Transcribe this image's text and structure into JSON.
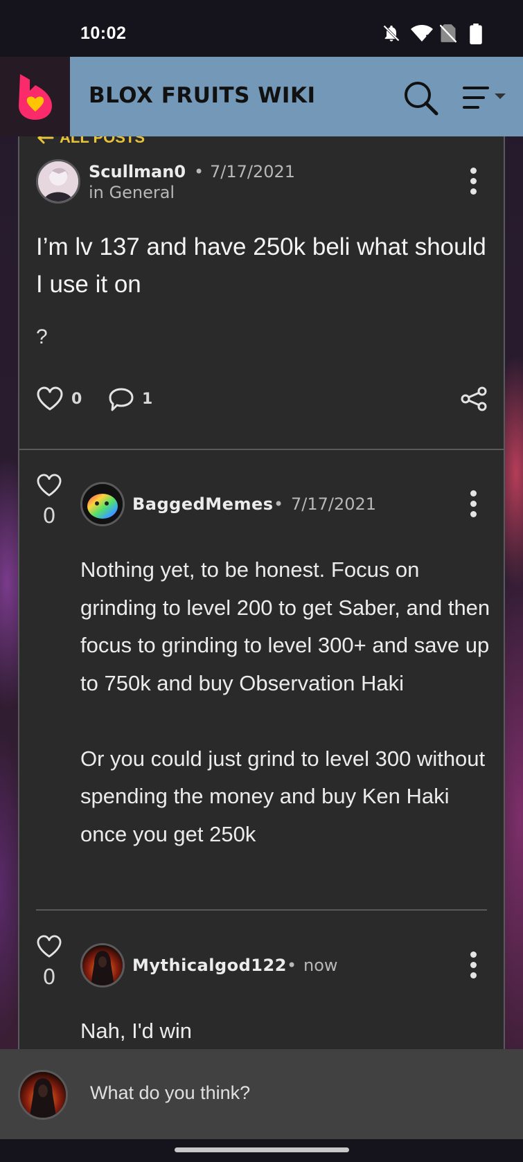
{
  "status_bar": {
    "time": "10:02",
    "icons": [
      "bell-off-icon",
      "wifi-icon",
      "no-sim-icon",
      "battery-icon"
    ]
  },
  "header": {
    "title": "BLOX FRUITS WIKI",
    "accent_color": "#7498b8",
    "logo_color": "#fa2a6b"
  },
  "nav": {
    "all_posts_label": "ALL POSTS"
  },
  "post": {
    "author": "Scullman0",
    "separator": "•",
    "date": "7/17/2021",
    "category": "in General",
    "title": "I’m lv 137 and have 250k beli what should I use it on",
    "body": "?",
    "likes": "0",
    "comments": "1"
  },
  "replies": [
    {
      "author": "BaggedMemes",
      "separator": "•",
      "date": "7/17/2021",
      "votes": "0",
      "text": "Nothing yet, to be honest. Focus on grinding to level 200 to get Saber, and then focus to grinding to level 300+ and save up to 750k and buy Observation Haki\n\nOr you could just grind to level 300 without spending the money and buy Ken Haki once you get 250k"
    },
    {
      "author": "Mythicalgod122",
      "separator": "•",
      "date": "now",
      "votes": "0",
      "text": "Nah, I'd win"
    }
  ],
  "composer": {
    "placeholder": "What do you think?"
  }
}
